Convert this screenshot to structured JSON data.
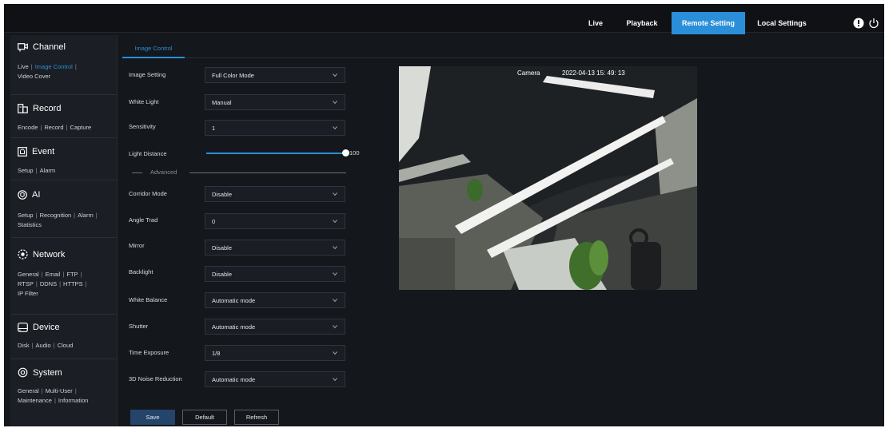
{
  "topnav": {
    "items": [
      {
        "label": "Live"
      },
      {
        "label": "Playback"
      },
      {
        "label": "Remote Setting"
      },
      {
        "label": "Local Settings"
      }
    ],
    "active_color": "#2a8fd8",
    "icons": [
      "alert-icon",
      "power-icon"
    ]
  },
  "sidebar": {
    "channel": {
      "title": "Channel",
      "links": [
        "Live",
        "Image Control",
        "Video Cover"
      ],
      "active": "Image Control"
    },
    "record": {
      "title": "Record",
      "links": [
        "Encode",
        "Record",
        "Capture"
      ]
    },
    "event": {
      "title": "Event",
      "links": [
        "Setup",
        "Alarm"
      ]
    },
    "ai": {
      "title": "AI",
      "links": [
        "Setup",
        "Recognition",
        "Alarm",
        "Statistics"
      ]
    },
    "network": {
      "title": "Network",
      "links": [
        "General",
        "Email",
        "FTP",
        "RTSP",
        "DDNS",
        "HTTPS",
        "IP Filter"
      ]
    },
    "device": {
      "title": "Device",
      "links": [
        "Disk",
        "Audio",
        "Cloud"
      ]
    },
    "system": {
      "title": "System",
      "links": [
        "General",
        "Multi-User",
        "Maintenance",
        "Information"
      ]
    }
  },
  "tabs": [
    {
      "label": "Image Control"
    }
  ],
  "settings": {
    "image_setting": {
      "label": "Image Setting",
      "value": "Full Color Mode"
    },
    "white_light": {
      "label": "White Light",
      "value": "Manual"
    },
    "sensitivity": {
      "label": "Sensitivity",
      "value": "1"
    },
    "light_distance": {
      "label": "Light Distance",
      "value": "100",
      "fraction": 1.0
    },
    "advanced_label": "Advanced",
    "corridor_mode": {
      "label": "Corridor Mode",
      "value": "Disable"
    },
    "angle_trad": {
      "label": "Angle Trad",
      "value": "0"
    },
    "mirror": {
      "label": "Mirror",
      "value": "Disable"
    },
    "backlight": {
      "label": "Backlight",
      "value": "Disable"
    },
    "white_balance": {
      "label": "White Balance",
      "value": "Automatic mode"
    },
    "shutter": {
      "label": "Shutter",
      "value": "Automatic mode"
    },
    "time_exposure": {
      "label": "Time Exposure",
      "value": "1/8"
    },
    "noise_reduction": {
      "label": "3D Noise Reduction",
      "value": "Automatic mode"
    }
  },
  "buttons": {
    "save": "Save",
    "default": "Default",
    "refresh": "Refresh"
  },
  "camera": {
    "name": "Camera",
    "timestamp": "2022-04-13  15: 49: 13"
  }
}
